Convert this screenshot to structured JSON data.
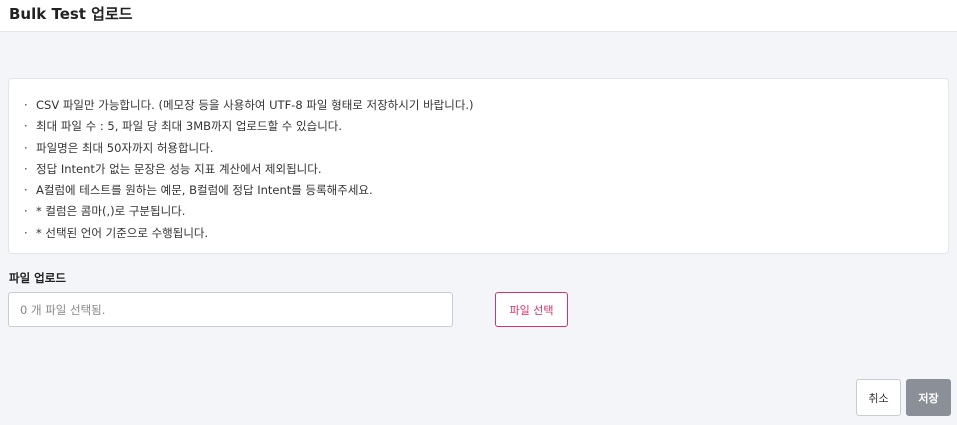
{
  "header": {
    "title": "Bulk Test 업로드"
  },
  "notice": {
    "bullet": "·",
    "items": [
      "CSV 파일만 가능합니다. (메모장 등을 사용하여 UTF-8 파일 형태로 저장하시기 바랍니다.)",
      "최대 파일 수 : 5, 파일 당 최대 3MB까지 업로드할 수 있습니다.",
      "파일명은 최대 50자까지 허용합니다.",
      "정답 Intent가 없는 문장은 성능 지표 계산에서 제외됩니다.",
      "A컬럼에 테스트를 원하는 예문, B컬럼에 정답 Intent를 등록해주세요.",
      "* 컬럼은 콤마(,)로 구분됩니다.",
      "* 선택된 언어 기준으로 수행됩니다."
    ]
  },
  "upload": {
    "label": "파일 업로드",
    "placeholder": "0 개 파일 선택됨.",
    "select_button": "파일 선택"
  },
  "footer": {
    "cancel_label": "취소",
    "save_label": "저장"
  },
  "colors": {
    "accent": "#d6336c",
    "save_button": "#8a8f98"
  }
}
